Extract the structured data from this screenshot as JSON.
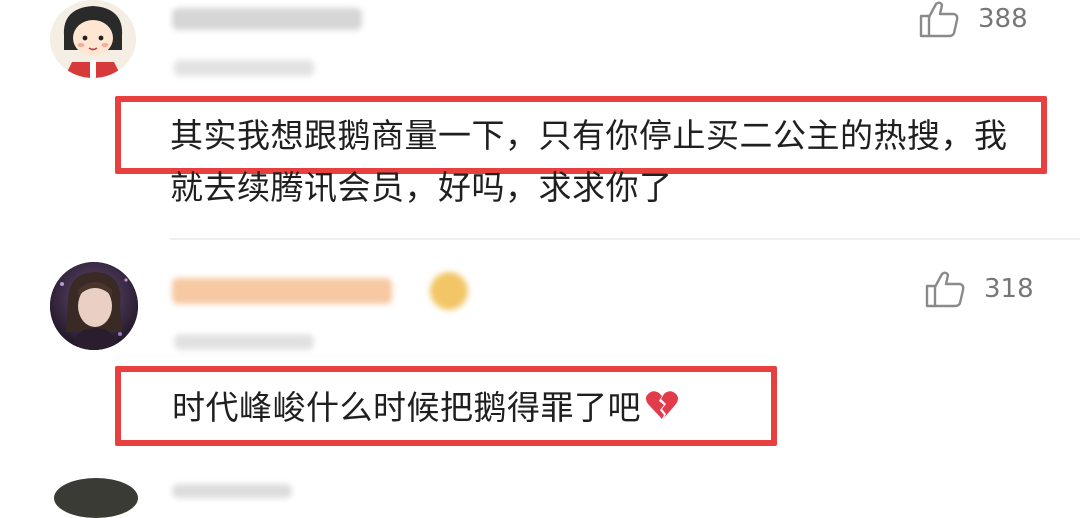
{
  "comments": [
    {
      "likes": "388",
      "text": "其实我想跟鹅商量一下，只有你停止买二公主的热搜，我就去续腾讯会员，好吗，求求你了"
    },
    {
      "likes": "318",
      "text": "时代峰峻什么时候把鹅得罪了吧"
    }
  ],
  "icons": {
    "like": "thumbs-up-icon",
    "heart": "broken-heart-icon"
  },
  "colors": {
    "highlight": "#e8403f",
    "like_count": "#777777"
  }
}
